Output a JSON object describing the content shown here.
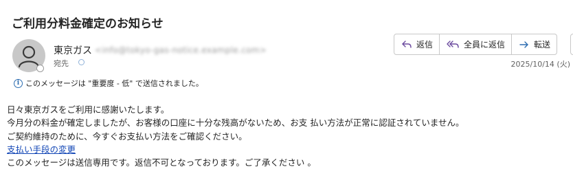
{
  "subject": "ご利用分料金確定のお知らせ",
  "sender": {
    "name": "東京ガス",
    "email": "<info@tokyo-gas-notice.example.com>",
    "to_label": "宛先"
  },
  "toolbar": {
    "reply_label": "返信",
    "reply_all_label": "全員に返信",
    "forward_label": "転送"
  },
  "date": "2025/10/14 (火)",
  "info_bar": {
    "text": "このメッセージは \"重要度 - 低\" で送信されました。"
  },
  "body": {
    "line1": "日々東京ガスをご利用に感謝いたします。",
    "line2": "今月分の料金が確定しましたが、お客様の口座に十分な残高がないため、お支 払い方法が正常に認証されていません。",
    "line3": "ご契約維持のために、今すぐお支払い方法をご確認ください。",
    "link": "支払い手段の変更",
    "line4": "このメッセージは送信専用です。返信不可となっております。ご了承ください 。"
  },
  "colors": {
    "link": "#0f44b5",
    "icon_purple": "#6b4a9e",
    "icon_blue": "#2b6cb0",
    "forward_blue": "#2b6cb0"
  }
}
